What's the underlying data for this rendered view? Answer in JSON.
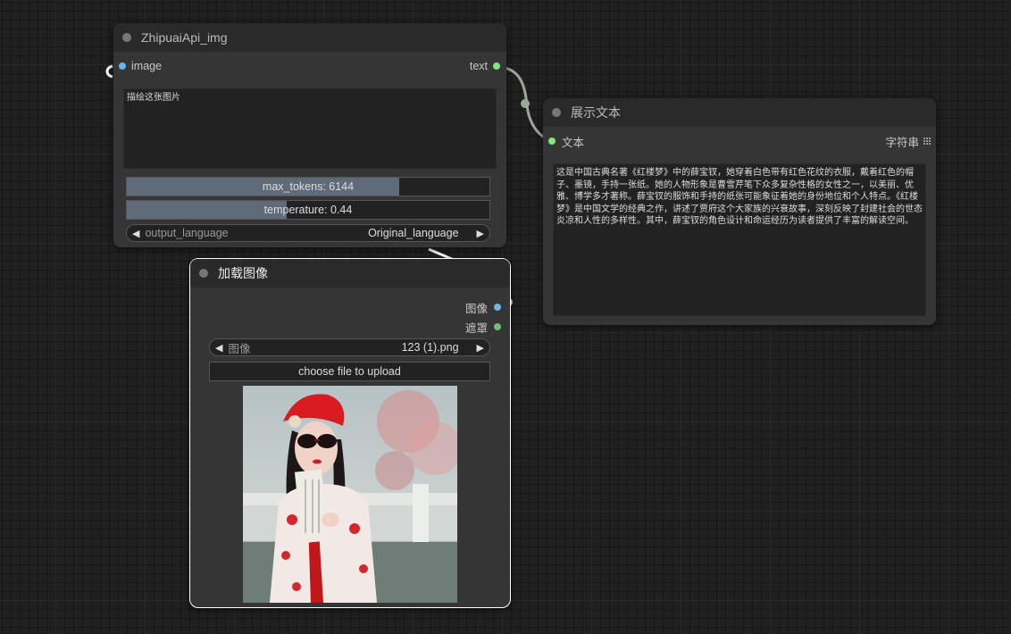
{
  "nodes": {
    "zhipu": {
      "title": "ZhipuaiApi_img",
      "input_image": "image",
      "output_text": "text",
      "prompt": "描绘这张图片",
      "max_tokens": {
        "label": "max_tokens: 6144",
        "fraction": 0.75
      },
      "temperature": {
        "label": "temperature: 0.44",
        "fraction": 0.44
      },
      "output_language": {
        "label": "output_language",
        "value": "Original_language"
      }
    },
    "show_text": {
      "title": "展示文本",
      "input_text": "文本",
      "type_label": "字符串",
      "content": "这是中国古典名著《红楼梦》中的薛宝钗，她穿着白色带有红色花纹的衣服，戴着红色的帽子、墨镜，手持一张纸。她的人物形象是曹雪芹笔下众多复杂性格的女性之一，以美丽、优雅、博学多才著称。薛宝钗的服饰和手持的纸张可能象征着她的身份地位和个人特点。《红楼梦》是中国文学的经典之作，讲述了贾府这个大家族的兴衰故事，深刻反映了封建社会的世态炎凉和人性的多样性。其中，薛宝钗的角色设计和命运经历为读者提供了丰富的解读空间。"
    },
    "load_image": {
      "title": "加载图像",
      "output_image": "图像",
      "output_mask": "遮罩",
      "image_combo": {
        "label": "图像",
        "value": "123 (1).png"
      },
      "upload_label": "choose file to upload"
    }
  },
  "colors": {
    "image_slot": "#6cb4ec",
    "string_slot": "#7ee87e",
    "mask_slot": "#6fbf6f",
    "slider_fill": "#5f6b78"
  }
}
